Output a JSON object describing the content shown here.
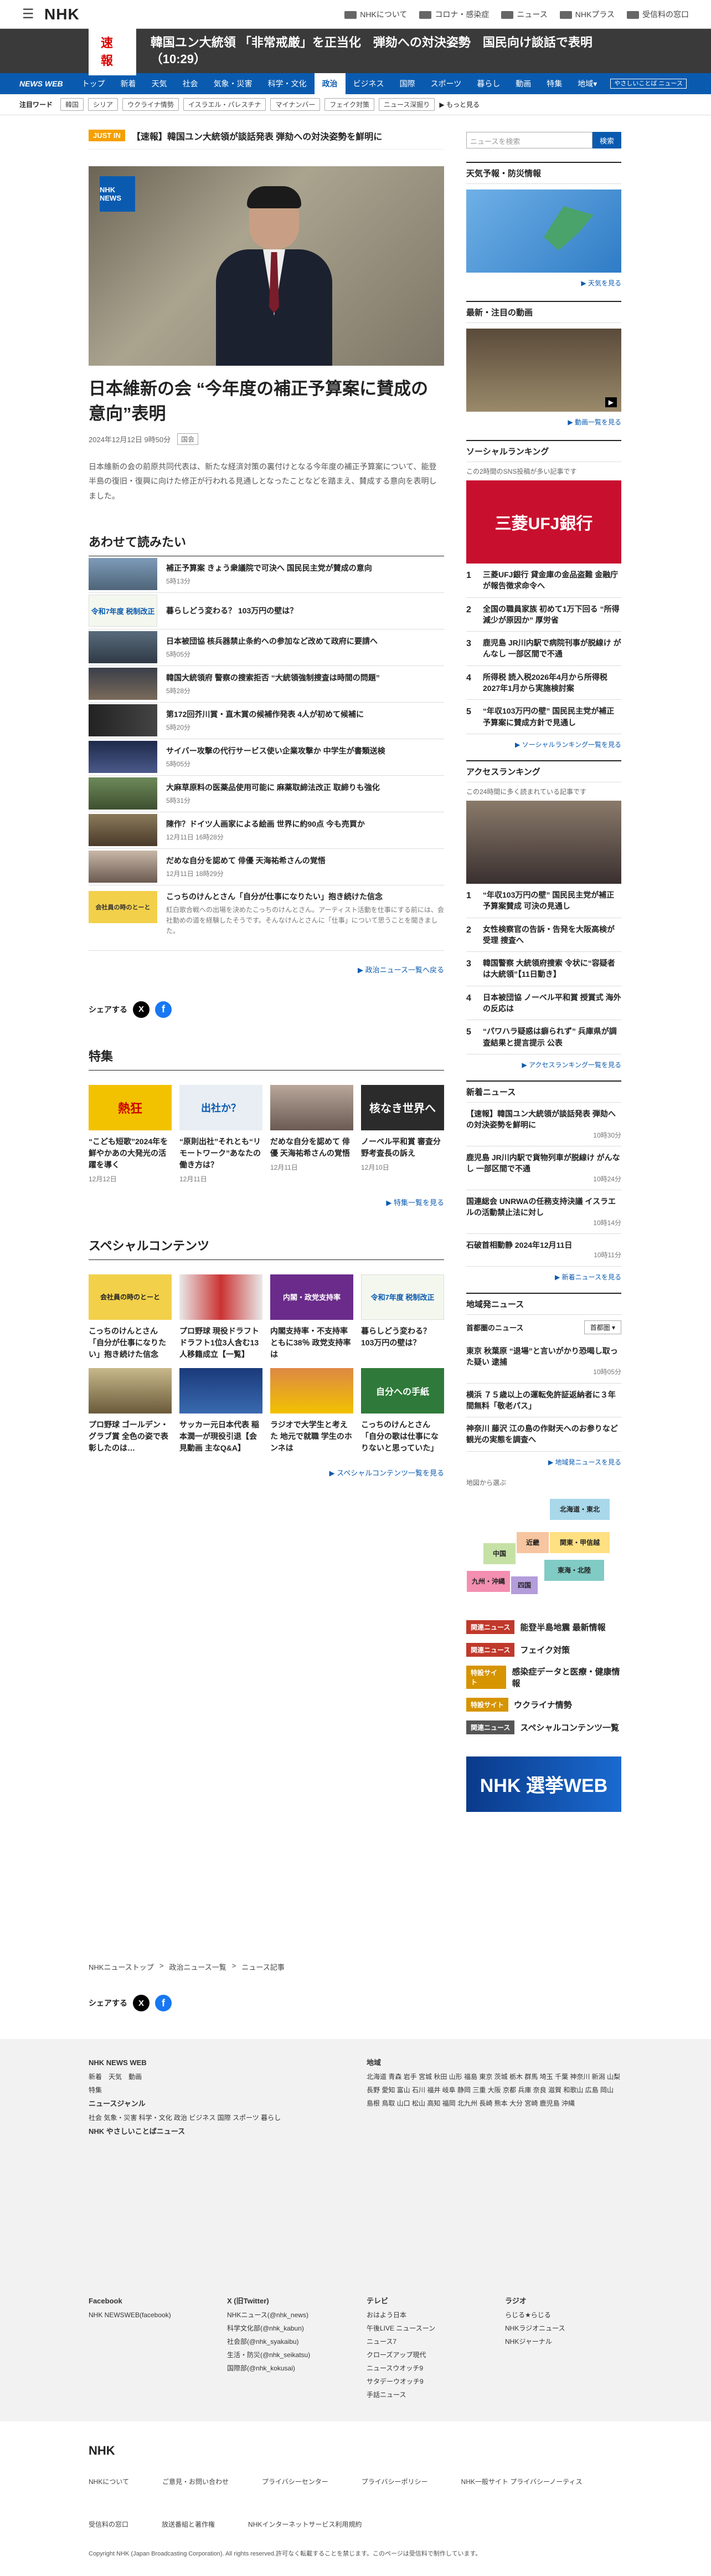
{
  "header": {
    "logo": "NHK",
    "links": [
      "NHKについて",
      "コロナ・感染症",
      "ニュース",
      "NHKプラス",
      "受信料の窓口"
    ]
  },
  "breaking": {
    "label": "速報",
    "text": "韓国ユン大統領 「非常戒厳」を正当化　弾劾への対決姿勢　国民向け談話で表明（10:29）"
  },
  "gnav": {
    "brand": "NEWS WEB",
    "items": [
      "トップ",
      "新着",
      "天気",
      "社会",
      "気象・災害",
      "科学・文化",
      "政治",
      "ビジネス",
      "国際",
      "スポーツ",
      "暮らし",
      "動画",
      "特集",
      "地域"
    ],
    "active": "政治",
    "easy": "やさしいことば ニュース",
    "region_arrow": "▾"
  },
  "keywords": {
    "label": "注目ワード",
    "tags": [
      "韓国",
      "シリア",
      "ウクライナ情勢",
      "イスラエル・パレスチナ",
      "マイナンバー",
      "フェイク対策",
      "ニュース深掘り"
    ],
    "more": "▶ もっと見る"
  },
  "ticker": {
    "label": "JUST IN",
    "text": "【速報】韓国ユン大統領が談話発表 弾劾への対決姿勢を鮮明に"
  },
  "article": {
    "logo_text": "NHK NEWS",
    "title": "日本維新の会 “今年度の補正予算案に賛成の意向”表明",
    "date": "2024年12月12日 9時50分",
    "category": "国会",
    "lead": "日本維新の会の前原共同代表は、新たな経済対策の裏付けとなる今年度の補正予算案について、能登半島の復旧・復興に向けた修正が行われる見通しとなったことなどを踏まえ、賛成する意向を表明しました。"
  },
  "related": {
    "heading": "あわせて読みたい",
    "items": [
      {
        "title": "補正予算案 きょう衆議院で可決へ 国民民主党が賛成の意向",
        "date": "5時13分"
      },
      {
        "title": "暮らしどう変わる？ 103万円の壁は？",
        "date": "",
        "thumb_text": "令和7年度 税制改正"
      },
      {
        "title": "日本被団協 核兵器禁止条約への参加など改めて政府に要請へ",
        "date": "5時05分"
      },
      {
        "title": "韓国大統領府 警察の捜索拒否 “大統領強制捜査は時間の問題”",
        "date": "5時28分"
      },
      {
        "title": "第172回芥川賞・直木賞の候補作発表 4人が初めて候補に",
        "date": "5時20分"
      },
      {
        "title": "サイバー攻撃の代行サービス使い企業攻撃か 中学生が書類送検",
        "date": "5時05分"
      },
      {
        "title": "大麻草原料の医薬品使用可能に 麻薬取締法改正 取締りも強化",
        "date": "5時31分"
      },
      {
        "title": "陳作？ドイツ人画家による絵画 世界に約90点 今も売買か",
        "date": "12月11日 16時28分"
      },
      {
        "title": "だめな自分を認めて 俳優 天海祐希さんの覚悟",
        "date": "12月11日 18時29分"
      },
      {
        "title": "こっちのけんとさん「自分が仕事になりたい」抱き続けた信念",
        "date": "",
        "desc": "紅白歌合戦への出場を決めたこっちのけんとさん。アーティスト活動を仕事にする前には、会社勤めの道を経験したそうです。そんなけんとさんに「仕事」について思うことを聞きました。",
        "thumb_text": "会社員の時のとーと"
      }
    ],
    "more": "▶ 政治ニュース一覧へ戻る"
  },
  "share": {
    "label": "シェアする",
    "x": "X",
    "fb": "f"
  },
  "features": {
    "heading": "特集",
    "items": [
      {
        "title": "“こども短歌”2024年を鮮やかあの大発光の活躍を導く",
        "date": "12月12日",
        "thumb_text": "熱狂"
      },
      {
        "title": "“原則出社”それとも“リモートワーク”あなたの働き方は？",
        "date": "12月11日",
        "thumb_text": "出社か？"
      },
      {
        "title": "だめな自分を認めて 俳優 天海祐希さんの覚悟",
        "date": "12月11日",
        "thumb_text": ""
      },
      {
        "title": "ノーベル平和賞 審査分野考査長の訴え",
        "date": "12月10日",
        "thumb_text": "核なき世界へ"
      }
    ],
    "more": "▶ 特集一覧を見る"
  },
  "special": {
    "heading": "スペシャルコンテンツ",
    "items": [
      {
        "title": "こっちのけんとさん「自分が仕事になりたい」抱き続けた信念",
        "thumb_text": "会社員の時のとーと"
      },
      {
        "title": "プロ野球 現役ドラフト ドラフト1位3人含む13人移籍成立【一覧】",
        "thumb_text": ""
      },
      {
        "title": "内閣支持率・不支持率ともに38％ 政党支持率は",
        "thumb_text": "内閣・政党支持率"
      },
      {
        "title": "暮らしどう変わる？ 103万円の壁は？",
        "thumb_text": "令和7年度 税制改正"
      },
      {
        "title": "プロ野球 ゴールデン・グラブ賞 全色の姿で表彰したのは…",
        "thumb_text": ""
      },
      {
        "title": "サッカー元日本代表 稲本潤一が現役引退【会見動画 主なQ&A】",
        "thumb_text": ""
      },
      {
        "title": "ラジオで大学生と考えた 地元で就職 学生のホンネは",
        "thumb_text": ""
      },
      {
        "title": "こっちのけんとさん「自分の歌は仕事になりないと思っていた」",
        "thumb_text": "自分への手紙"
      }
    ],
    "more": "▶ スペシャルコンテンツ一覧を見る"
  },
  "breadcrumb": [
    "NHKニューストップ",
    "政治ニュース一覧",
    "ニュース記事"
  ],
  "sidebar": {
    "search_placeholder": "ニュースを検索",
    "search_button": "検索",
    "weather": {
      "heading": "天気予報・防災情報",
      "more": "▶ 天気を見る"
    },
    "video": {
      "heading": "最新・注目の動画",
      "more": "▶ 動画一覧を見る"
    },
    "social": {
      "heading": "ソーシャルランキング",
      "sub": "この2時間のSNS投稿が多い記事です",
      "banner": "三菱UFJ銀行",
      "items": [
        {
          "rank": "1",
          "title": "三菱UFJ銀行 貸金庫の金品盗難 金融庁が報告徴求命令へ"
        },
        {
          "rank": "2",
          "title": "全国の職員家族 初めて1万下回る “所得減少が原因か” 厚労省"
        },
        {
          "rank": "3",
          "title": "鹿児島 JR川内駅で病院刊事が脱線け がんなし 一部区間で不通"
        },
        {
          "rank": "4",
          "title": "所得税 読入税2026年4月から所得税2027年1月から実施検討案"
        },
        {
          "rank": "5",
          "title": "“年収103万円の壁” 国民民主党が補正予算案に賛成方針で見通し"
        }
      ],
      "more": "▶ ソーシャルランキング一覧を見る"
    },
    "access": {
      "heading": "アクセスランキング",
      "sub": "この24時間に多く読まれている記事です",
      "items": [
        {
          "rank": "1",
          "title": "“年収103万円の壁” 国民民主党が補正予算案賛成 可決の見通し"
        },
        {
          "rank": "2",
          "title": "女性検察官の告訴・告発を大阪高検が受理 捜査へ"
        },
        {
          "rank": "3",
          "title": "韓国警察 大統領府捜索 令状に“容疑者は大統領”【11日動き】"
        },
        {
          "rank": "4",
          "title": "日本被団協 ノーベル平和賞 授賞式 海外の反応は"
        },
        {
          "rank": "5",
          "title": "“パワハラ疑惑は癖られず” 兵庫県が調査結果と提言提示 公表"
        }
      ],
      "more": "▶ アクセスランキング一覧を見る"
    },
    "latest": {
      "heading": "新着ニュース",
      "items": [
        {
          "title": "【速報】韓国ユン大統領が談話発表 弾劾への対決姿勢を鮮明に",
          "date": "10時30分"
        },
        {
          "title": "鹿児島 JR川内駅で貨物列車が脱線け がんなし 一部区間で不通",
          "date": "10時24分"
        },
        {
          "title": "国連総会 UNRWAの任務支持決議 イスラエルの活動禁止法に対し",
          "date": "10時14分"
        },
        {
          "title": "石破首相動静 2024年12月11日",
          "date": "10時11分"
        }
      ],
      "more": "▶ 新着ニュースを見る"
    },
    "local": {
      "heading": "地域発ニュース",
      "area": "首都圏のニュース",
      "select": "首都圏 ▾",
      "items": [
        {
          "title": "東京 秋葉原 “退場”と言いがかり恐喝し取った疑い 逮捕",
          "date": "10時05分"
        },
        {
          "title": "横浜 ７５歳以上の運転免許証返納者に３年間無料「敬老パス」",
          "date": ""
        },
        {
          "title": "神奈川 藤沢 江の島の作財天へのお参りなど観光の実態を調査へ",
          "date": ""
        }
      ],
      "more": "▶ 地域発ニュースを見る",
      "map_label": "地図から選ぶ",
      "regions": [
        "北海道・東北",
        "近畿",
        "中国",
        "関東・甲信越",
        "九州・沖縄",
        "四国",
        "東海・北陸"
      ]
    },
    "promos": [
      {
        "tag": "関連ニュース",
        "title": "能登半島地震 最新情報"
      },
      {
        "tag": "関連ニュース",
        "title": "フェイク対策"
      },
      {
        "tag": "特設サイト",
        "title": "感染症データと医療・健康情報"
      },
      {
        "tag": "特設サイト",
        "title": "ウクライナ情勢"
      },
      {
        "tag": "関連ニュース",
        "title": "スペシャルコンテンツ一覧"
      }
    ],
    "election_banner": "NHK 選挙WEB"
  },
  "footer": {
    "col1_title": "NHK NEWS WEB",
    "col1_items": [
      "新着",
      "天気",
      "動画",
      "特集"
    ],
    "genre_title": "ニュースジャンル",
    "genres": "社会 気象・災害 科学・文化 政治 ビジネス 国際 スポーツ 暮らし",
    "easy": "NHK やさしいことばニュース",
    "region_title": "地域",
    "regions": "北海道 青森 岩手 宮城 秋田 山形 福島 東京 茨城 栃木 群馬 埼玉 千葉 神奈川 新潟 山梨 長野 愛知 富山 石川 福井 岐阜 静岡 三重 大阪 京都 兵庫 奈良 滋賀 和歌山 広島 岡山 島根 鳥取 山口 松山 高知 福岡 北九州 長崎 熊本 大分 宮崎 鹿児島 沖縄",
    "sns": [
      {
        "title": "Facebook",
        "items": [
          "NHK NEWSWEB(facebook)"
        ]
      },
      {
        "title": "X (旧Twitter)",
        "items": [
          "NHKニュース(@nhk_news)",
          "科学文化部(@nhk_kabun)",
          "社会部(@nhk_syakaibu)",
          "生活・防災(@nhk_seikatsu)",
          "国際部(@nhk_kokusai)"
        ]
      },
      {
        "title": "テレビ",
        "items": [
          "おはよう日本",
          "午後LIVE ニュースーン",
          "ニュース7",
          "クローズアップ現代",
          "ニュースウオッチ9",
          "サタデーウオッチ9",
          "手話ニュース"
        ]
      },
      {
        "title": "ラジオ",
        "items": [
          "らじる★らじる",
          "NHKラジオニュース",
          "NHKジャーナル"
        ]
      }
    ],
    "bottom_links": [
      "NHKについて",
      "ご意見・お問い合わせ",
      "プライバシーセンター",
      "プライバシーポリシー",
      "NHK一般サイト プライバシーノーティス",
      "受信料の窓口",
      "放送番組と著作権",
      "NHKインターネットサービス利用規約"
    ],
    "copyright": "Copyright NHK (Japan Broadcasting Corporation). All rights reserved.許可なく転載することを禁じます。このページは受信料で制作しています。"
  }
}
